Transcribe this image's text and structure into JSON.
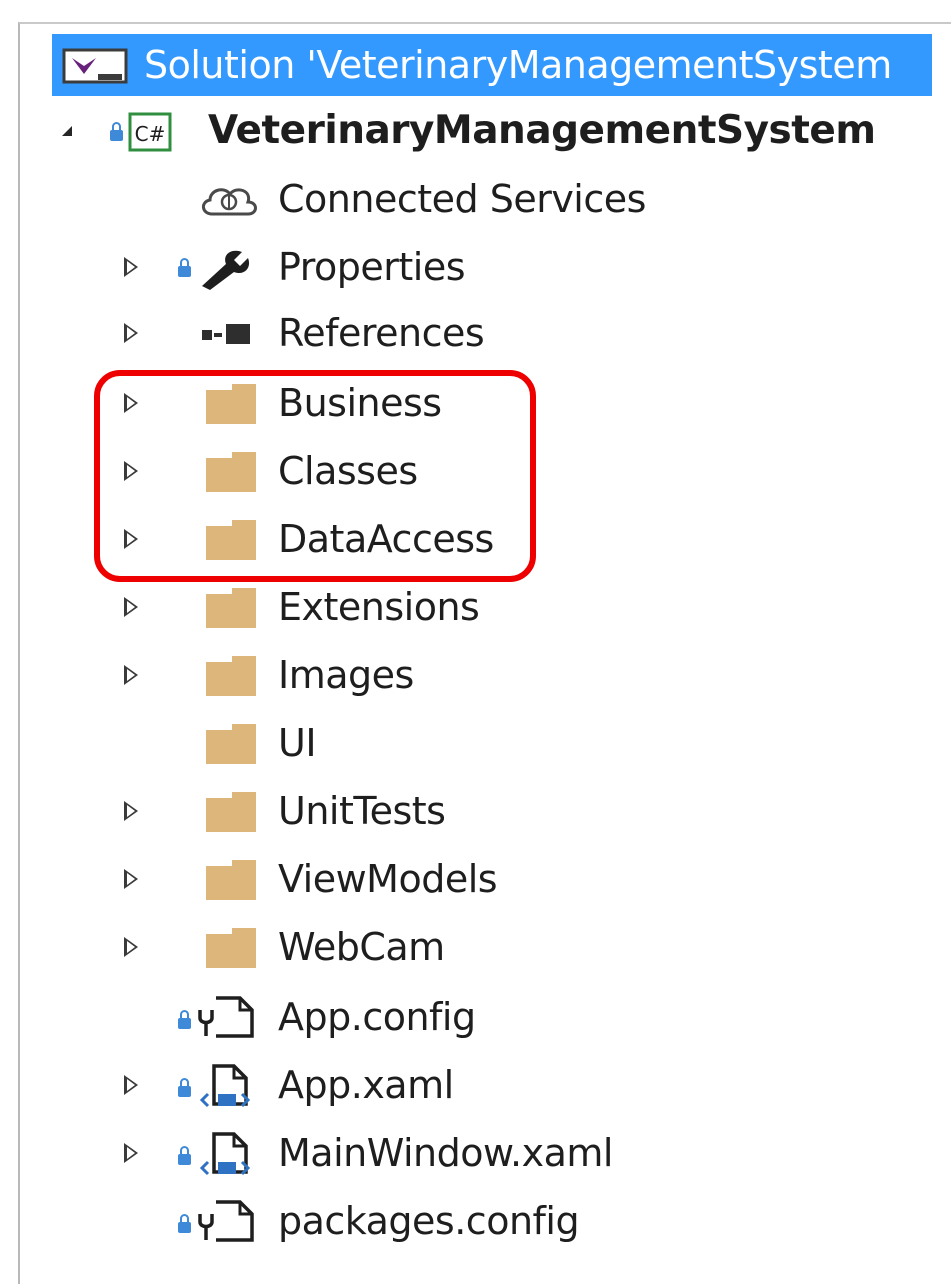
{
  "solution": {
    "label": "Solution 'VeterinaryManagementSystem",
    "selected_color": "#3399ff",
    "icon": "visual-studio-solution-icon"
  },
  "project": {
    "label": "VeterinaryManagementSystem",
    "icon": "csharp-project-icon",
    "icon_text": "C#",
    "expanded": true
  },
  "items": [
    {
      "id": "connected-services",
      "label": "Connected Services",
      "icon": "cloud-icon",
      "expander": false
    },
    {
      "id": "properties",
      "label": "Properties",
      "icon": "wrench-icon",
      "expander": true,
      "locked": true
    },
    {
      "id": "references",
      "label": "References",
      "icon": "references-icon",
      "expander": true
    },
    {
      "id": "business",
      "label": "Business",
      "icon": "folder-icon",
      "expander": true
    },
    {
      "id": "classes",
      "label": "Classes",
      "icon": "folder-icon",
      "expander": true
    },
    {
      "id": "dataaccess",
      "label": "DataAccess",
      "icon": "folder-icon",
      "expander": true
    },
    {
      "id": "extensions",
      "label": "Extensions",
      "icon": "folder-icon",
      "expander": true
    },
    {
      "id": "images",
      "label": "Images",
      "icon": "folder-icon",
      "expander": true
    },
    {
      "id": "ui",
      "label": "UI",
      "icon": "folder-icon",
      "expander": false
    },
    {
      "id": "unittests",
      "label": "UnitTests",
      "icon": "folder-icon",
      "expander": true
    },
    {
      "id": "viewmodels",
      "label": "ViewModels",
      "icon": "folder-icon",
      "expander": true
    },
    {
      "id": "webcam",
      "label": "WebCam",
      "icon": "folder-icon",
      "expander": true
    },
    {
      "id": "app-config",
      "label": "App.config",
      "icon": "config-file-icon",
      "expander": false,
      "locked": true
    },
    {
      "id": "app-xaml",
      "label": "App.xaml",
      "icon": "xaml-file-icon",
      "expander": true,
      "locked": true
    },
    {
      "id": "mainwindow-xaml",
      "label": "MainWindow.xaml",
      "icon": "xaml-file-icon",
      "expander": true,
      "locked": true
    },
    {
      "id": "packages-config",
      "label": "packages.config",
      "icon": "config-file-icon",
      "expander": false,
      "locked": true
    }
  ],
  "annotation": {
    "highlight_color": "#ee0000",
    "highlighted_items": [
      "business",
      "classes",
      "dataaccess"
    ]
  },
  "colors": {
    "folder": "#dcb67a",
    "lock": "#3f8ad8",
    "text": "#1e1e1e"
  }
}
